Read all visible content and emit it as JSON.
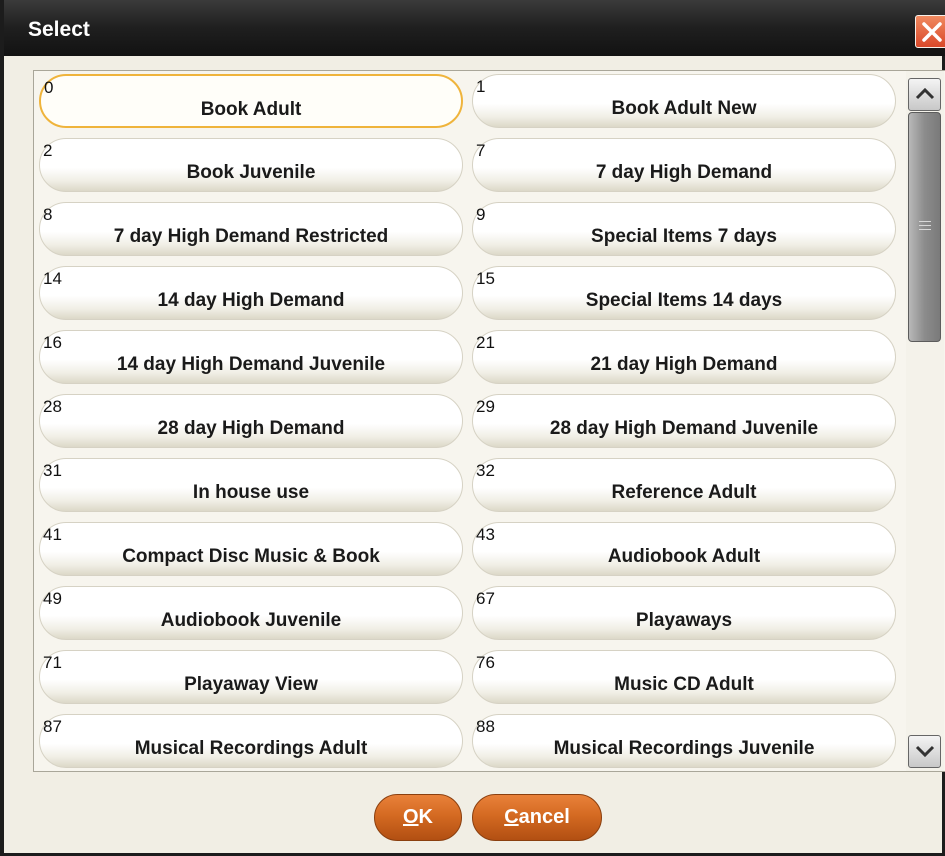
{
  "dialog": {
    "title": "Select",
    "close_icon": "close-x-icon"
  },
  "items": [
    {
      "code": "0",
      "label": "Book Adult",
      "selected": true
    },
    {
      "code": "1",
      "label": "Book Adult New"
    },
    {
      "code": "2",
      "label": "Book Juvenile"
    },
    {
      "code": "7",
      "label": "7 day High Demand"
    },
    {
      "code": "8",
      "label": "7 day High Demand Restricted"
    },
    {
      "code": "9",
      "label": "Special Items 7 days"
    },
    {
      "code": "14",
      "label": "14 day High Demand"
    },
    {
      "code": "15",
      "label": "Special Items 14 days"
    },
    {
      "code": "16",
      "label": "14 day High Demand Juvenile"
    },
    {
      "code": "21",
      "label": "21 day High Demand"
    },
    {
      "code": "28",
      "label": "28 day High Demand"
    },
    {
      "code": "29",
      "label": "28 day High Demand Juvenile"
    },
    {
      "code": "31",
      "label": "In house use"
    },
    {
      "code": "32",
      "label": "Reference Adult"
    },
    {
      "code": "41",
      "label": "Compact Disc Music & Book"
    },
    {
      "code": "43",
      "label": "Audiobook Adult"
    },
    {
      "code": "49",
      "label": "Audiobook Juvenile"
    },
    {
      "code": "67",
      "label": "Playaways"
    },
    {
      "code": "71",
      "label": "Playaway View"
    },
    {
      "code": "76",
      "label": "Music CD Adult"
    },
    {
      "code": "87",
      "label": "Musical Recordings Adult"
    },
    {
      "code": "88",
      "label": "Musical Recordings Juvenile"
    }
  ],
  "scrollbar": {
    "up_icon": "scroll-up-arrow-icon",
    "down_icon": "scroll-down-arrow-icon"
  },
  "buttons": {
    "ok": {
      "mnemonic": "O",
      "rest": "K"
    },
    "cancel": {
      "mnemonic": "C",
      "rest": "ancel"
    }
  },
  "colors": {
    "title_bar": "#1f1f1f",
    "close_button": "#e0542e",
    "button_orange": "#d46a22",
    "selected_outline": "#efb43c",
    "dialog_bg": "#f1eee4"
  }
}
